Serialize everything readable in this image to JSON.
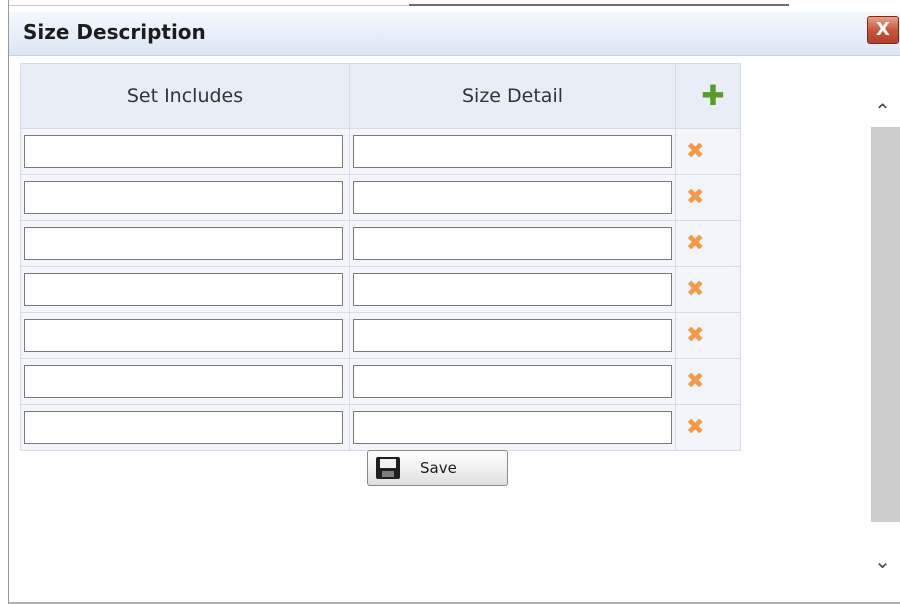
{
  "dialog": {
    "title": "Size Description",
    "close_label": "X"
  },
  "table": {
    "headers": [
      "Set Includes",
      "Size Detail"
    ],
    "add_icon": "plus-icon",
    "remove_icon": "x-icon",
    "rows": [
      {
        "set_includes": "",
        "size_detail": ""
      },
      {
        "set_includes": "",
        "size_detail": ""
      },
      {
        "set_includes": "",
        "size_detail": ""
      },
      {
        "set_includes": "",
        "size_detail": ""
      },
      {
        "set_includes": "",
        "size_detail": ""
      },
      {
        "set_includes": "",
        "size_detail": ""
      },
      {
        "set_includes": "",
        "size_detail": ""
      }
    ]
  },
  "save_button": {
    "label": "Save",
    "icon": "floppy-disk-icon"
  },
  "scrollbar": {
    "up_icon": "chevron-up-icon",
    "down_icon": "chevron-down-icon"
  },
  "colors": {
    "add": "#5a9a2a",
    "remove": "#f29a4a",
    "close": "#c8583c",
    "header_bg": "#e9edf6"
  }
}
